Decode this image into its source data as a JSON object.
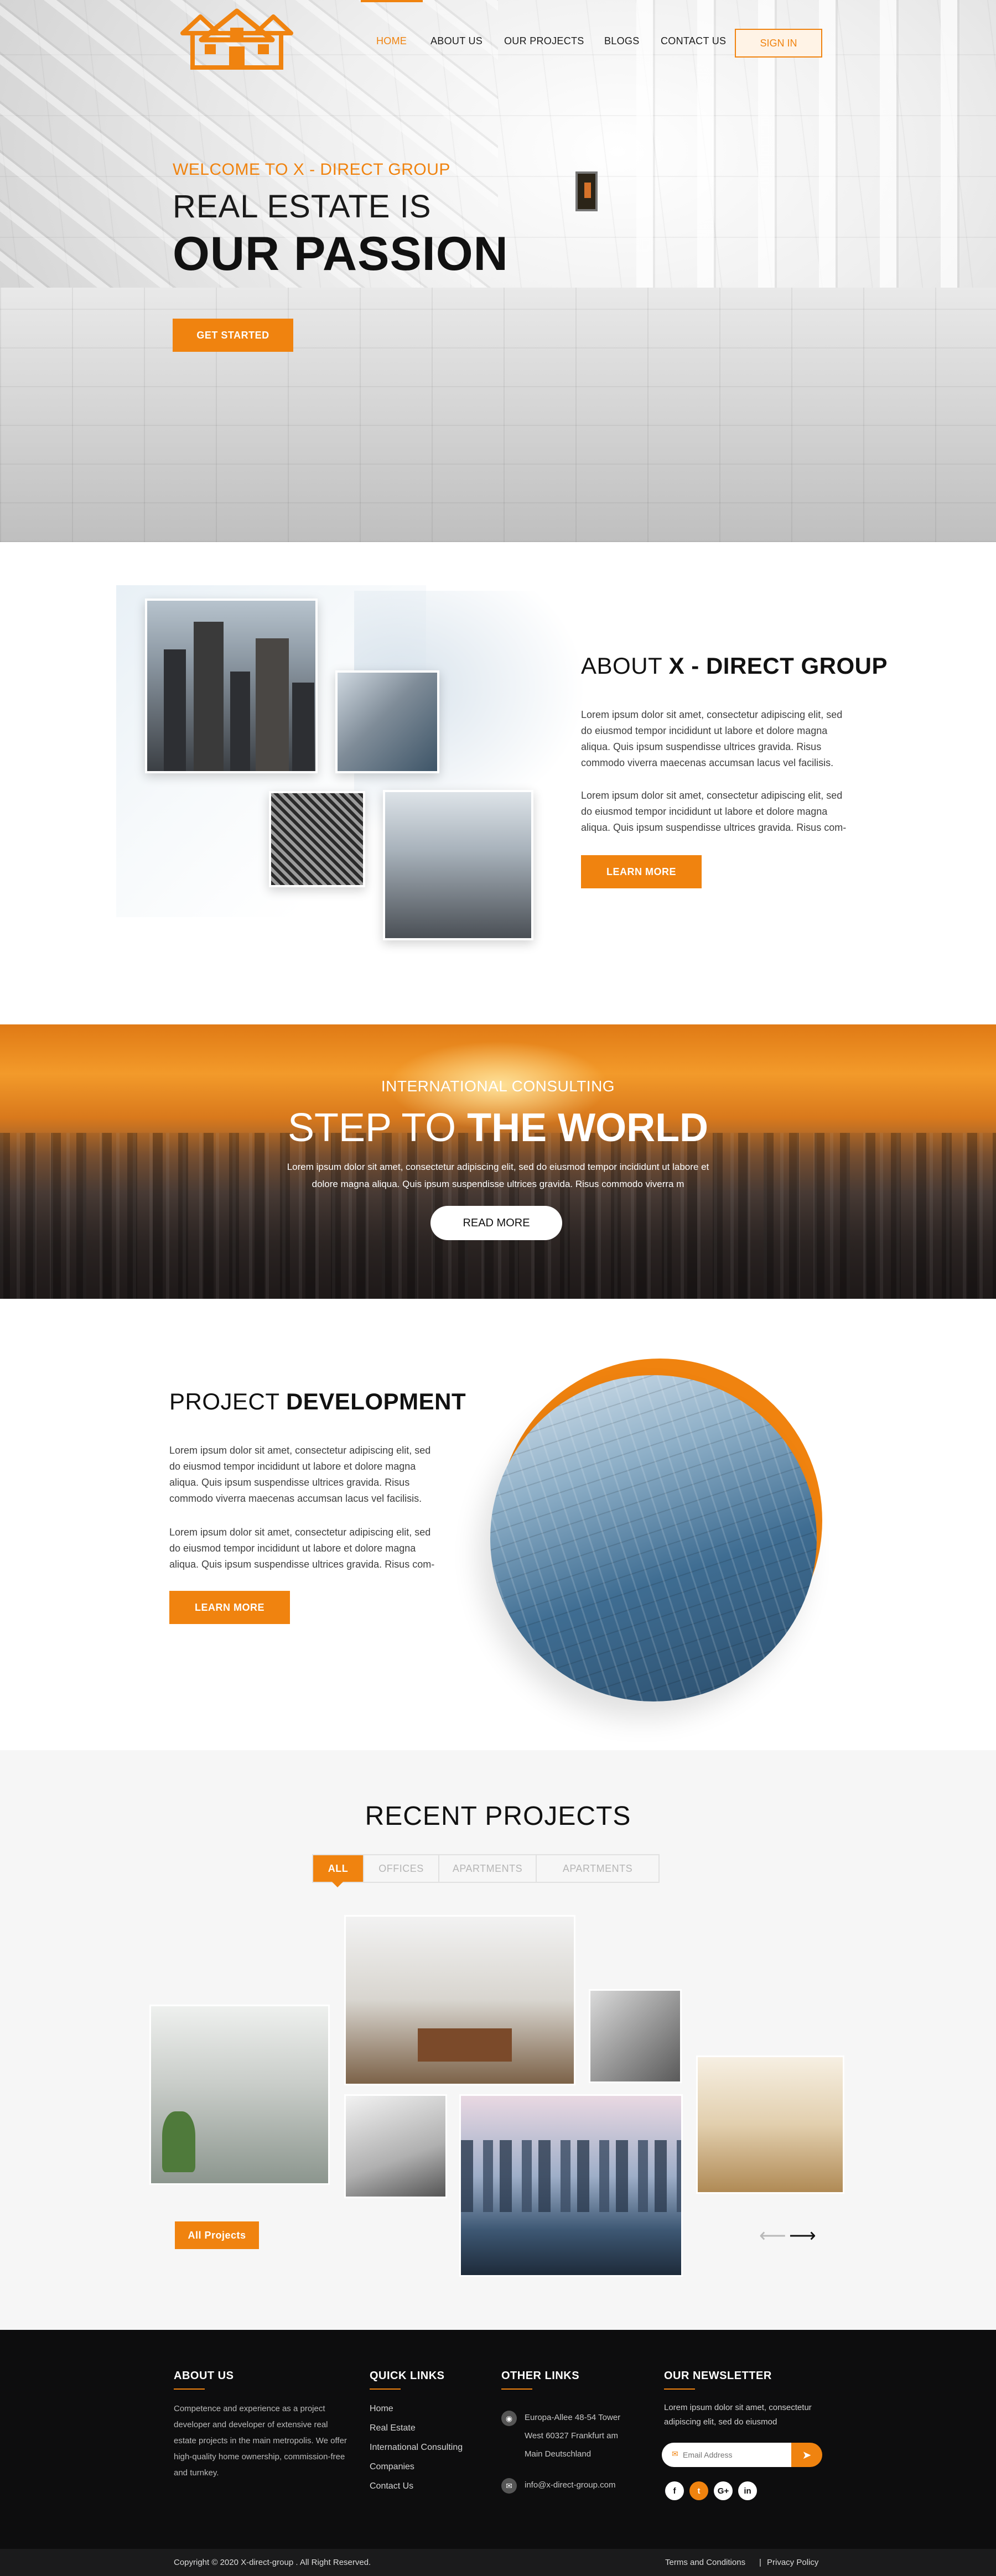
{
  "brand": {
    "accent": "#f0830f",
    "dark": "#0d0d0e",
    "logo_icon": "house-logo-icon"
  },
  "nav": {
    "items": [
      "HOME",
      "ABOUT US",
      "OUR PROJECTS",
      "BLOGS",
      "CONTACT US"
    ],
    "active_index": 0,
    "signin": "SIGN IN"
  },
  "hero": {
    "welcome": "WELCOME TO X - DIRECT GROUP",
    "line1": "REAL ESTATE IS",
    "line2": "OUR PASSION",
    "cta": "GET STARTED"
  },
  "about": {
    "title_light": "ABOUT",
    "title_bold": "X - DIRECT GROUP",
    "p1": "Lorem ipsum dolor sit amet, consectetur adipiscing elit, sed do eiusmod tempor incididunt ut labore et dolore magna aliqua. Quis ipsum suspendisse ultrices gravida. Risus commodo viverra maecenas accumsan lacus vel facilisis.",
    "p2": "Lorem ipsum dolor sit amet, consectetur adipiscing elit, sed do eiusmod tempor incididunt ut labore et dolore magna aliqua. Quis ipsum suspendisse ultrices gravida. Risus com-",
    "cta": "LEARN MORE"
  },
  "consulting": {
    "subtitle": "INTERNATIONAL CONSULTING",
    "title_light": "STEP TO",
    "title_bold": "THE WORLD",
    "text": "Lorem ipsum dolor sit amet, consectetur adipiscing elit, sed do eiusmod tempor incididunt ut labore et dolore magna aliqua. Quis ipsum suspendisse ultrices gravida. Risus commodo viverra m",
    "cta": "READ MORE"
  },
  "project_dev": {
    "title_light": "PROJECT",
    "title_bold": "DEVELOPMENT",
    "p1": "Lorem ipsum dolor sit amet, consectetur adipiscing elit, sed do eiusmod tempor incididunt ut labore et dolore magna aliqua. Quis ipsum suspendisse ultrices gravida. Risus commodo viverra maecenas accumsan lacus vel facilisis.",
    "p2": "Lorem ipsum dolor sit amet, consectetur adipiscing elit, sed do eiusmod tempor incididunt ut labore et dolore magna aliqua. Quis ipsum suspendisse ultrices gravida. Risus com-",
    "cta": "LEARN MORE"
  },
  "recent": {
    "title": "RECENT PROJECTS",
    "tabs": [
      "ALL",
      "OFFICES",
      "APARTMENTS",
      "APARTMENTS"
    ],
    "active_tab": 0,
    "all_button": "All Projects",
    "prev_icon": "arrow-left-icon",
    "next_icon": "arrow-right-icon"
  },
  "footer": {
    "about": {
      "title": "ABOUT US",
      "text": "Competence and experience as a project developer and developer of extensive real estate projects in the main metropolis. We offer high-quality home ownership, commission-free and turnkey."
    },
    "quick_links": {
      "title": "QUICK LINKS",
      "items": [
        "Home",
        "Real Estate",
        "International Consulting",
        "Companies",
        "Contact Us"
      ]
    },
    "other_links": {
      "title": "OTHER LINKS",
      "address": [
        "Europa-Allee 48-54 Tower",
        "West 60327 Frankfurt am",
        "Main Deutschland"
      ],
      "email": "info@x-direct-group.com"
    },
    "newsletter": {
      "title": "OUR NEWSLETTER",
      "text": "Lorem ipsum dolor sit amet, consectetur adipiscing elit, sed do eiusmod",
      "placeholder": "Email Address",
      "social": [
        "f",
        "t",
        "G+",
        "in"
      ]
    },
    "copyright": "Copyright © 2020 X-direct-group . All Right Reserved.",
    "terms": "Terms and Conditions",
    "separator": "|",
    "privacy": "Privacy Policy"
  }
}
